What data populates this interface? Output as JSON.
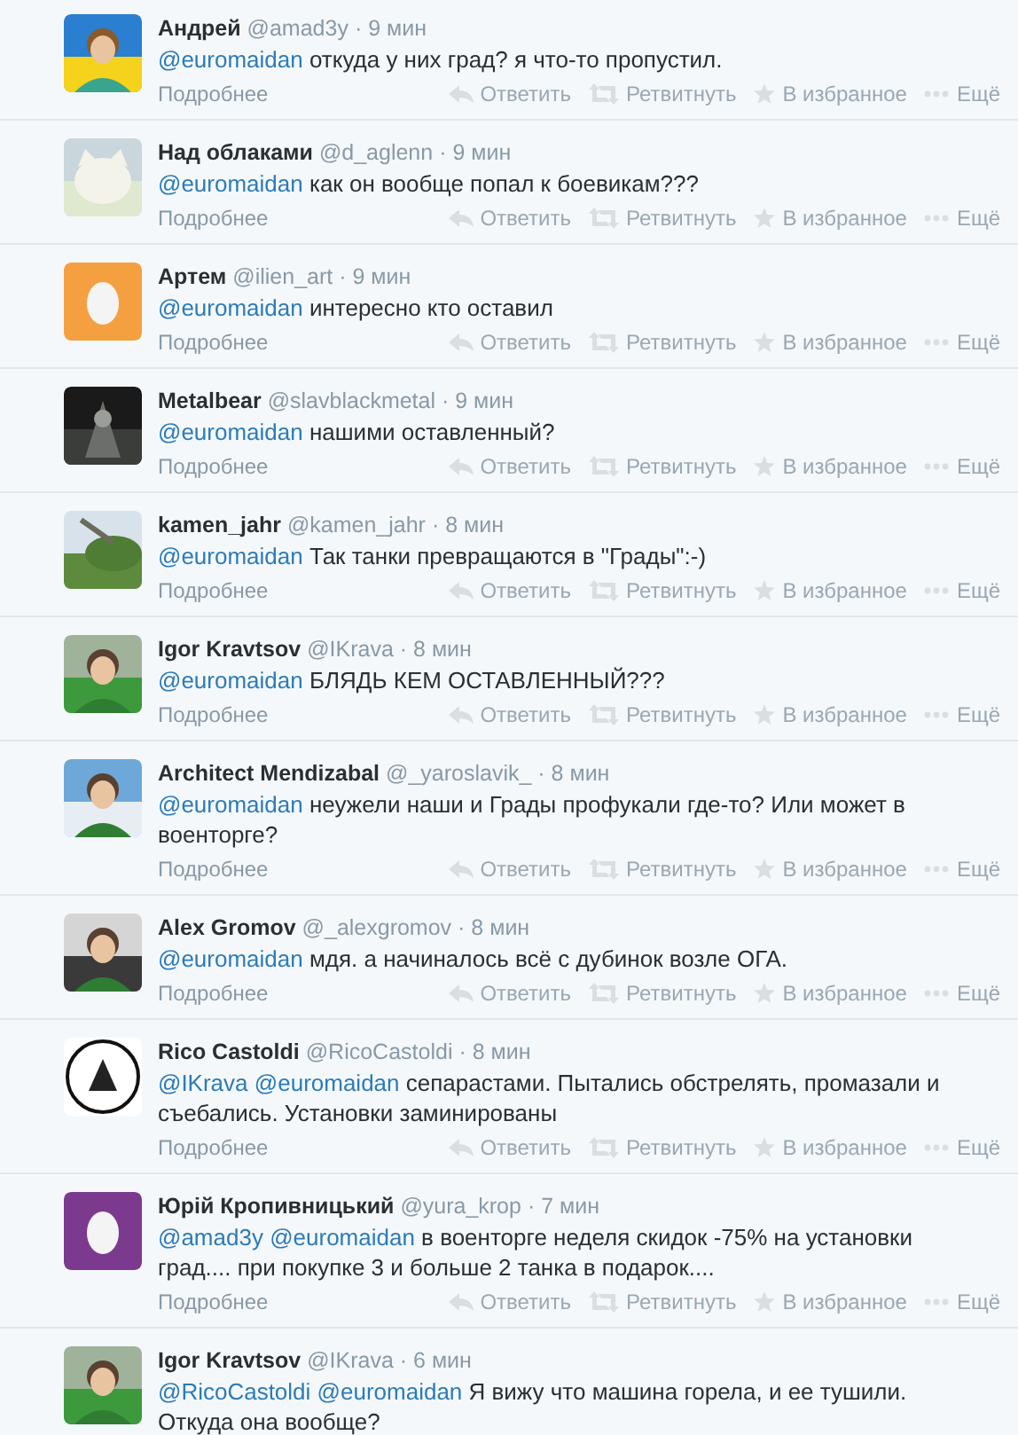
{
  "tweets": [
    {
      "avatar": {
        "kind": "cartoon"
      },
      "name": "Андрей",
      "handle": "@amad3y",
      "time": "· 9 мин",
      "text": [
        {
          "kind": "mention",
          "text": "@euromaidan"
        },
        {
          "kind": "text",
          "text": " откуда у них град? я что-то пропустил."
        }
      ],
      "details": "Подробнее",
      "actions": [
        {
          "kind": "reply",
          "label": "Ответить"
        },
        {
          "kind": "retweet",
          "label": "Ретвитнуть"
        },
        {
          "kind": "favorite",
          "label": "В избранное"
        },
        {
          "kind": "more",
          "label": "Ещё"
        }
      ]
    },
    {
      "avatar": {
        "kind": "cat"
      },
      "name": "Над облаками",
      "handle": "@d_aglenn",
      "time": "· 9 мин",
      "text": [
        {
          "kind": "mention",
          "text": "@euromaidan"
        },
        {
          "kind": "text",
          "text": " как он вообще попал к боевикам???"
        }
      ],
      "details": "Подробнее",
      "actions": [
        {
          "kind": "reply",
          "label": "Ответить"
        },
        {
          "kind": "retweet",
          "label": "Ретвитнуть"
        },
        {
          "kind": "favorite",
          "label": "В избранное"
        },
        {
          "kind": "more",
          "label": "Ещё"
        }
      ]
    },
    {
      "avatar": {
        "kind": "egg",
        "color": "#f5a040"
      },
      "name": "Артем",
      "handle": "@ilien_art",
      "time": "· 9 мин",
      "text": [
        {
          "kind": "mention",
          "text": "@euromaidan"
        },
        {
          "kind": "text",
          "text": " интересно кто оставил"
        }
      ],
      "details": "Подробнее",
      "actions": [
        {
          "kind": "reply",
          "label": "Ответить"
        },
        {
          "kind": "retweet",
          "label": "Ретвитнуть"
        },
        {
          "kind": "favorite",
          "label": "В избранное"
        },
        {
          "kind": "more",
          "label": "Ещё"
        }
      ]
    },
    {
      "avatar": {
        "kind": "dark"
      },
      "name": "Metalbear",
      "handle": "@slavblackmetal",
      "time": "· 9 мин",
      "text": [
        {
          "kind": "mention",
          "text": "@euromaidan"
        },
        {
          "kind": "text",
          "text": " нашими оставленный?"
        }
      ],
      "details": "Подробнее",
      "actions": [
        {
          "kind": "reply",
          "label": "Ответить"
        },
        {
          "kind": "retweet",
          "label": "Ретвитнуть"
        },
        {
          "kind": "favorite",
          "label": "В избранное"
        },
        {
          "kind": "more",
          "label": "Ещё"
        }
      ]
    },
    {
      "avatar": {
        "kind": "landscape"
      },
      "name": "kamen_jahr",
      "handle": "@kamen_jahr",
      "time": "· 8 мин",
      "text": [
        {
          "kind": "mention",
          "text": "@euromaidan"
        },
        {
          "kind": "text",
          "text": " Так танки превращаются в \"Грады\":-)"
        }
      ],
      "details": "Подробнее",
      "actions": [
        {
          "kind": "reply",
          "label": "Ответить"
        },
        {
          "kind": "retweet",
          "label": "Ретвитнуть"
        },
        {
          "kind": "favorite",
          "label": "В избранное"
        },
        {
          "kind": "more",
          "label": "Ещё"
        }
      ]
    },
    {
      "avatar": {
        "kind": "person"
      },
      "name": "Igor Kravtsov",
      "handle": "@IKrava",
      "time": "· 8 мин",
      "text": [
        {
          "kind": "mention",
          "text": "@euromaidan"
        },
        {
          "kind": "text",
          "text": " БЛЯДЬ КЕМ ОСТАВЛЕННЫЙ???"
        }
      ],
      "details": "Подробнее",
      "actions": [
        {
          "kind": "reply",
          "label": "Ответить"
        },
        {
          "kind": "retweet",
          "label": "Ретвитнуть"
        },
        {
          "kind": "favorite",
          "label": "В избранное"
        },
        {
          "kind": "more",
          "label": "Ещё"
        }
      ]
    },
    {
      "avatar": {
        "kind": "sky"
      },
      "name": "Architect Mendizabal",
      "handle": "@_yaroslavik_",
      "time": "· 8 мин",
      "text": [
        {
          "kind": "mention",
          "text": "@euromaidan"
        },
        {
          "kind": "text",
          "text": " неужели наши и Грады профукали где-то? Или может в военторге?"
        }
      ],
      "details": "Подробнее",
      "actions": [
        {
          "kind": "reply",
          "label": "Ответить"
        },
        {
          "kind": "retweet",
          "label": "Ретвитнуть"
        },
        {
          "kind": "favorite",
          "label": "В избранное"
        },
        {
          "kind": "more",
          "label": "Ещё"
        }
      ]
    },
    {
      "avatar": {
        "kind": "mono"
      },
      "name": "Alex Gromov",
      "handle": "@_alexgromov",
      "time": "· 8 мин",
      "text": [
        {
          "kind": "mention",
          "text": "@euromaidan"
        },
        {
          "kind": "text",
          "text": " мдя. а начиналось всё с дубинок возле ОГА."
        }
      ],
      "details": "Подробнее",
      "actions": [
        {
          "kind": "reply",
          "label": "Ответить"
        },
        {
          "kind": "retweet",
          "label": "Ретвитнуть"
        },
        {
          "kind": "favorite",
          "label": "В избранное"
        },
        {
          "kind": "more",
          "label": "Ещё"
        }
      ]
    },
    {
      "avatar": {
        "kind": "emblem"
      },
      "name": "Rico Castoldi",
      "handle": "@RicoCastoldi",
      "time": "· 8 мин",
      "text": [
        {
          "kind": "mention",
          "text": "@IKrava"
        },
        {
          "kind": "mention",
          "text": "@euromaidan"
        },
        {
          "kind": "text",
          "text": " сепарастами. Пытались обстрелять, промазали и съебались. Установки заминированы"
        }
      ],
      "details": "Подробнее",
      "actions": [
        {
          "kind": "reply",
          "label": "Ответить"
        },
        {
          "kind": "retweet",
          "label": "Ретвитнуть"
        },
        {
          "kind": "favorite",
          "label": "В избранное"
        },
        {
          "kind": "more",
          "label": "Ещё"
        }
      ]
    },
    {
      "avatar": {
        "kind": "egg",
        "color": "#7b3a8e"
      },
      "name": "Юрій Кропивницький",
      "handle": "@yura_krop",
      "time": "· 7 мин",
      "text": [
        {
          "kind": "mention",
          "text": "@amad3y"
        },
        {
          "kind": "mention",
          "text": "@euromaidan"
        },
        {
          "kind": "text",
          "text": " в военторге неделя скидок -75% на установки град.... при покупке 3 и больше 2 танка в подарок...."
        }
      ],
      "details": "Подробнее",
      "actions": [
        {
          "kind": "reply",
          "label": "Ответить"
        },
        {
          "kind": "retweet",
          "label": "Ретвитнуть"
        },
        {
          "kind": "favorite",
          "label": "В избранное"
        },
        {
          "kind": "more",
          "label": "Ещё"
        }
      ]
    },
    {
      "avatar": {
        "kind": "person"
      },
      "name": "Igor Kravtsov",
      "handle": "@IKrava",
      "time": "· 6 мин",
      "text": [
        {
          "kind": "mention",
          "text": "@RicoCastoldi"
        },
        {
          "kind": "mention",
          "text": "@euromaidan"
        },
        {
          "kind": "text",
          "text": " Я вижу что машина горела, и ее тушили. Откуда она вообще?"
        }
      ]
    }
  ]
}
